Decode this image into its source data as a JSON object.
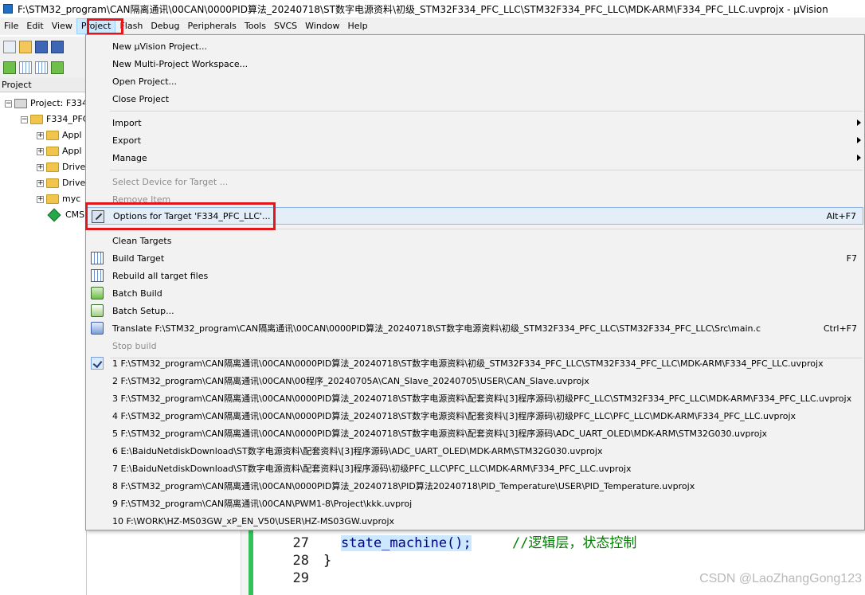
{
  "window": {
    "title": "F:\\STM32_program\\CAN隔离通讯\\00CAN\\0000PID算法_20240718\\ST数字电源资料\\初级_STM32F334_PFC_LLC\\STM32F334_PFC_LLC\\MDK-ARM\\F334_PFC_LLC.uvprojx - µVision"
  },
  "menubar": {
    "items": [
      "File",
      "Edit",
      "View",
      "Project",
      "Flash",
      "Debug",
      "Peripherals",
      "Tools",
      "SVCS",
      "Window",
      "Help"
    ],
    "active": "Project"
  },
  "project_panel": {
    "header": "Project",
    "tree": [
      {
        "label": "Project: F334",
        "icon": "project-icon"
      },
      {
        "label": "F334_PFC",
        "icon": "target-icon"
      },
      {
        "label": "Appl",
        "icon": "folder-icon"
      },
      {
        "label": "Appl",
        "icon": "folder-icon"
      },
      {
        "label": "Drive",
        "icon": "folder-icon"
      },
      {
        "label": "Drive",
        "icon": "folder-icon"
      },
      {
        "label": "myc",
        "icon": "folder-icon"
      },
      {
        "label": "CMS",
        "icon": "cmsis-icon"
      }
    ]
  },
  "project_menu": {
    "items": [
      {
        "label": "New µVision Project..."
      },
      {
        "label": "New Multi-Project Workspace..."
      },
      {
        "label": "Open Project..."
      },
      {
        "label": "Close Project"
      },
      {
        "label": "Import",
        "submenu": true
      },
      {
        "label": "Export",
        "submenu": true
      },
      {
        "label": "Manage",
        "submenu": true
      },
      {
        "label": "Select Device for Target ...",
        "disabled": true
      },
      {
        "label": "Remove Item",
        "disabled": true
      },
      {
        "label": "Options for Target 'F334_PFC_LLC'...",
        "shortcut": "Alt+F7",
        "icon": "wand-icon",
        "highlighted": true
      },
      {
        "label": "Clean Targets"
      },
      {
        "label": "Build Target",
        "shortcut": "F7",
        "icon": "build-icon"
      },
      {
        "label": "Rebuild all target files",
        "icon": "rebuild-icon"
      },
      {
        "label": "Batch Build",
        "icon": "batch-build-icon"
      },
      {
        "label": "Batch Setup...",
        "icon": "batch-setup-icon"
      },
      {
        "label": "Translate F:\\STM32_program\\CAN隔离通讯\\00CAN\\0000PID算法_20240718\\ST数字电源资料\\初级_STM32F334_PFC_LLC\\STM32F334_PFC_LLC\\Src\\main.c",
        "shortcut": "Ctrl+F7",
        "icon": "translate-icon"
      },
      {
        "label": "Stop build",
        "disabled": true
      }
    ],
    "recent": [
      {
        "label": "1 F:\\STM32_program\\CAN隔离通讯\\00CAN\\0000PID算法_20240718\\ST数字电源资料\\初级_STM32F334_PFC_LLC\\STM32F334_PFC_LLC\\MDK-ARM\\F334_PFC_LLC.uvprojx",
        "checked": true
      },
      {
        "label": "2 F:\\STM32_program\\CAN隔离通讯\\00CAN\\00程序_20240705A\\CAN_Slave_20240705\\USER\\CAN_Slave.uvprojx"
      },
      {
        "label": "3 F:\\STM32_program\\CAN隔离通讯\\00CAN\\0000PID算法_20240718\\ST数字电源资料\\配套资料\\[3]程序源码\\初级PFC_LLC\\STM32F334_PFC_LLC\\MDK-ARM\\F334_PFC_LLC.uvprojx"
      },
      {
        "label": "4 F:\\STM32_program\\CAN隔离通讯\\00CAN\\0000PID算法_20240718\\ST数字电源资料\\配套资料\\[3]程序源码\\初级PFC_LLC\\PFC_LLC\\MDK-ARM\\F334_PFC_LLC.uvprojx"
      },
      {
        "label": "5 F:\\STM32_program\\CAN隔离通讯\\00CAN\\0000PID算法_20240718\\ST数字电源资料\\配套资料\\[3]程序源码\\ADC_UART_OLED\\MDK-ARM\\STM32G030.uvprojx"
      },
      {
        "label": "6 E:\\BaiduNetdiskDownload\\ST数字电源资料\\配套资料\\[3]程序源码\\ADC_UART_OLED\\MDK-ARM\\STM32G030.uvprojx"
      },
      {
        "label": "7 E:\\BaiduNetdiskDownload\\ST数字电源资料\\配套资料\\[3]程序源码\\初级PFC_LLC\\PFC_LLC\\MDK-ARM\\F334_PFC_LLC.uvprojx"
      },
      {
        "label": "8 F:\\STM32_program\\CAN隔离通讯\\00CAN\\0000PID算法_20240718\\PID算法20240718\\PID_Temperature\\USER\\PID_Temperature.uvprojx"
      },
      {
        "label": "9 F:\\STM32_program\\CAN隔离通讯\\00CAN\\PWM1-8\\Project\\kkk.uvproj"
      },
      {
        "label": "10 F:\\WORK\\HZ-MS03GW_xP_EN_V50\\USER\\HZ-MS03GW.uvprojx"
      }
    ]
  },
  "editor": {
    "lines": [
      {
        "num": "27",
        "code": "state_machine();",
        "comment": "//逻辑层，状态控制"
      },
      {
        "num": "28",
        "code": "}",
        "comment": ""
      },
      {
        "num": "29",
        "code": "",
        "comment": ""
      }
    ]
  },
  "watermark": "CSDN @LaoZhangGong123",
  "colors": {
    "annotation_red": "#e3161c",
    "highlight": "#cce8ff"
  }
}
